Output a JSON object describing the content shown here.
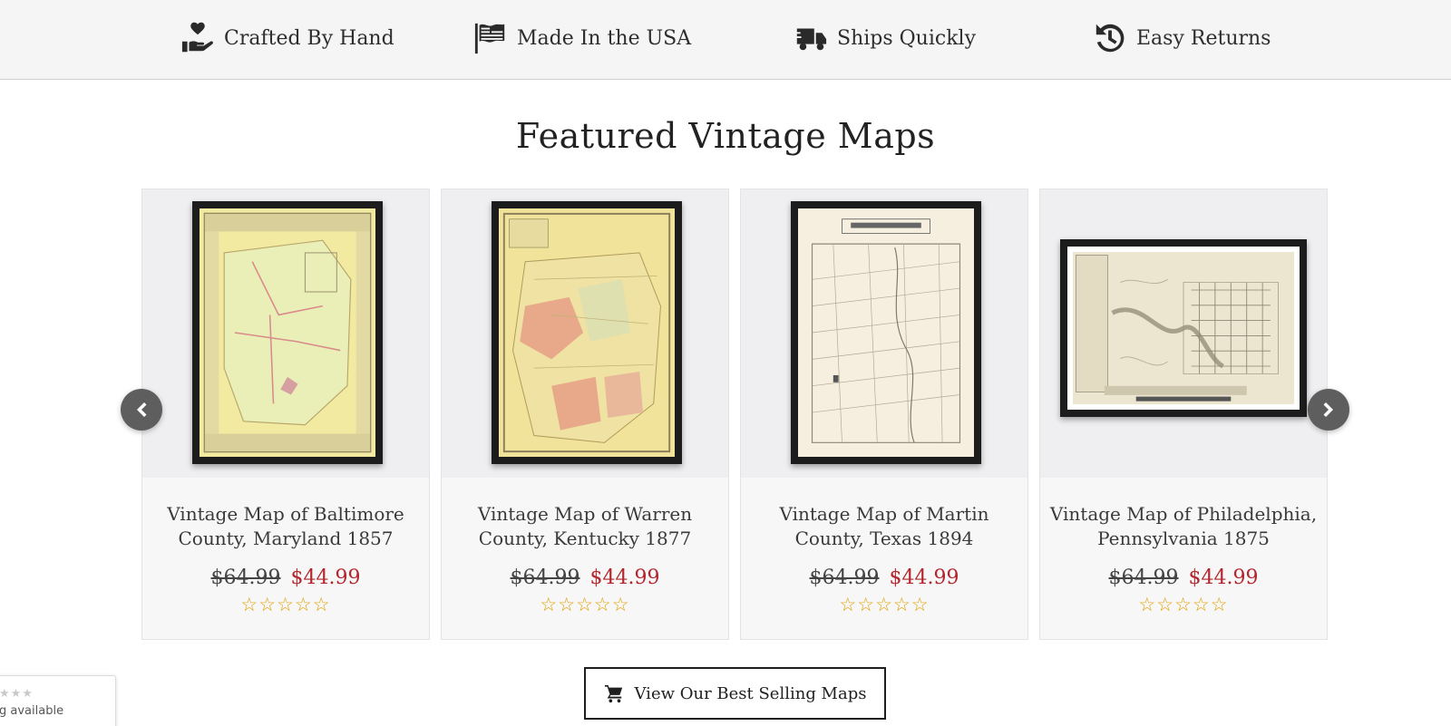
{
  "features": [
    {
      "label": "Crafted By Hand",
      "icon": "hand-heart-icon"
    },
    {
      "label": "Made In the USA",
      "icon": "flag-icon"
    },
    {
      "label": "Ships Quickly",
      "icon": "truck-icon"
    },
    {
      "label": "Easy Returns",
      "icon": "history-icon"
    }
  ],
  "section_title": "Featured Vintage Maps",
  "products": [
    {
      "title": "Vintage Map of Baltimore County, Maryland 1857",
      "old_price": "$64.99",
      "new_price": "$44.99",
      "stars": "☆☆☆☆☆",
      "rating": 0
    },
    {
      "title": "Vintage Map of Warren County, Kentucky 1877",
      "old_price": "$64.99",
      "new_price": "$44.99",
      "stars": "☆☆☆☆☆",
      "rating": 0
    },
    {
      "title": "Vintage Map of Martin County, Texas 1894",
      "old_price": "$64.99",
      "new_price": "$44.99",
      "stars": "☆☆☆☆☆",
      "rating": 0
    },
    {
      "title": "Vintage Map of Philadelphia, Pennsylvania 1875",
      "old_price": "$64.99",
      "new_price": "$44.99",
      "stars": "☆☆☆☆☆",
      "rating": 0
    }
  ],
  "cta_label": "View Our Best Selling Maps",
  "rating_widget": {
    "stars": "★★★",
    "text": "g available"
  },
  "colors": {
    "sale_price": "#b3262d",
    "stars": "#e0a100",
    "arrow_bg": "#5e5e5e",
    "feature_bar_bg": "#f5f5f5"
  }
}
